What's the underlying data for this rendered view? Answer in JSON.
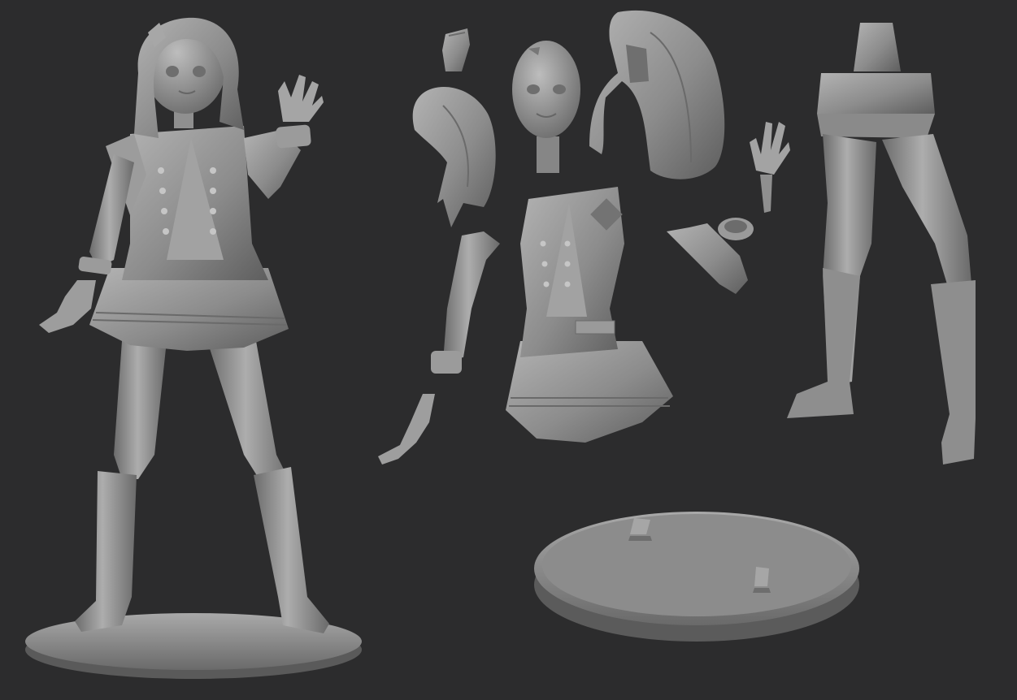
{
  "scene": {
    "background": "#2c2c2d",
    "material_base": "#8a8a8a",
    "material_light": "#b0b0b0",
    "material_shadow": "#555555",
    "objects": [
      "assembled-figure",
      "hair-bun-piece",
      "hair-side-piece",
      "head-piece",
      "hair-back-piece",
      "left-hand-raised-piece",
      "torso-skirt-piece",
      "left-arm-piece",
      "right-arm-piece",
      "right-hand-piece",
      "legs-piece",
      "base-stand-piece"
    ]
  }
}
